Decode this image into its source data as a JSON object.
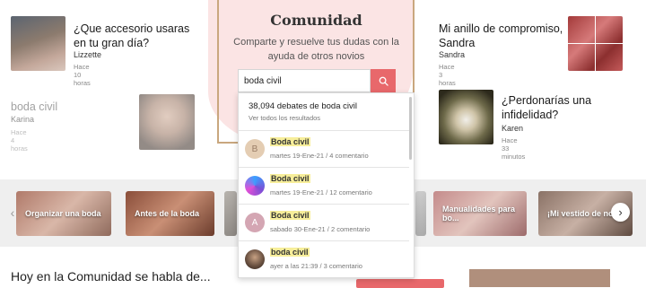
{
  "hero": {
    "title": "Comunidad",
    "subtitle": "Comparte y resuelve tus dudas con la ayuda de otros novios"
  },
  "search": {
    "value": "boda civil",
    "placeholder": "",
    "icon": "search-icon"
  },
  "questions": [
    {
      "title": "¿Que accesorio usaras en tu gran día?",
      "author": "Lizzette",
      "time": "Hace 10 horas"
    },
    {
      "title": "boda civil",
      "author": "Karina",
      "time": "Hace 4 horas"
    },
    {
      "title": "Mi anillo de compromiso, Sandra",
      "author": "Sandra",
      "time": "Hace 3 horas"
    },
    {
      "title": "¿Perdonarías una infidelidad?",
      "author": "Karen",
      "time": "Hace 33 minutos"
    }
  ],
  "dropdown": {
    "count_label": "38,094 debates de boda civil",
    "see_all": "Ver todos los resultados",
    "results": [
      {
        "title": "Boda civil",
        "meta": "martes 19-Ene-21 / 4 comentario",
        "initial": "B",
        "avatar_color": "#e4cdb3"
      },
      {
        "title": "Boda civil",
        "meta": "martes 19-Ene-21 / 12 comentario",
        "initial": "",
        "avatar_color": "#7b4fd6"
      },
      {
        "title": "Boda civil",
        "meta": "sabado 30-Ene-21 / 2 comentario",
        "initial": "A",
        "avatar_color": "#d4a6b3"
      },
      {
        "title": "boda civil",
        "meta": "ayer a las 21:39 / 3 comentario",
        "initial": "",
        "avatar_color": "#5a4436"
      }
    ]
  },
  "categories": [
    {
      "label": "Organizar una boda"
    },
    {
      "label": "Antes de la boda"
    },
    {
      "label": ""
    },
    {
      "label": ""
    },
    {
      "label": "Manualidades para bo..."
    },
    {
      "label": "¡Mi vestido de no..."
    }
  ],
  "bottom": {
    "heading": "Hoy en la Comunidad se habla de..."
  },
  "colors": {
    "accent": "#e8686b",
    "hero_bg": "#fbe4e4",
    "highlight": "#f7ee9a"
  }
}
